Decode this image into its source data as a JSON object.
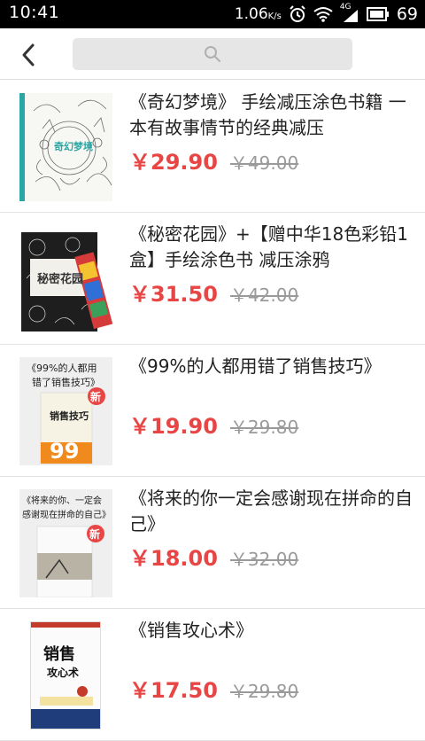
{
  "status": {
    "time": "10:41",
    "speed": "1.06",
    "speed_unit": "K/s",
    "network": "4G",
    "battery": "69"
  },
  "search": {
    "placeholder": ""
  },
  "books": [
    {
      "title": "《奇幻梦境》 手绘减压涂色书籍 一本有故事情节的经典减压",
      "price": "￥29.90",
      "old_price": "￥49.00"
    },
    {
      "title": "《秘密花园》+【赠中华18色彩铅1盒】手绘涂色书 减压涂鸦",
      "price": "￥31.50",
      "old_price": "￥42.00"
    },
    {
      "title": "《99%的人都用错了销售技巧》",
      "price": "￥19.90",
      "old_price": "￥29.80"
    },
    {
      "title": "《将来的你一定会感谢现在拼命的自己》",
      "price": "￥18.00",
      "old_price": "￥32.00"
    },
    {
      "title": "《销售攻心术》",
      "price": "￥17.50",
      "old_price": "￥29.80"
    }
  ],
  "covers": {
    "c1": {
      "title": "奇幻梦境"
    },
    "c2": {
      "title": "秘密花园"
    },
    "c3": {
      "line1": "《99%的人都用",
      "line2": "错了销售技巧》",
      "badge": "新",
      "name": "销售技巧",
      "big": "99"
    },
    "c4": {
      "line1": "《将来的你、一定会",
      "line2": "感谢现在拼命的自己》",
      "badge": "新"
    },
    "c5": {
      "name": "销售",
      "sub": "攻心术"
    }
  },
  "colors": {
    "accent": "#e84545",
    "statusbar": "#000000"
  }
}
